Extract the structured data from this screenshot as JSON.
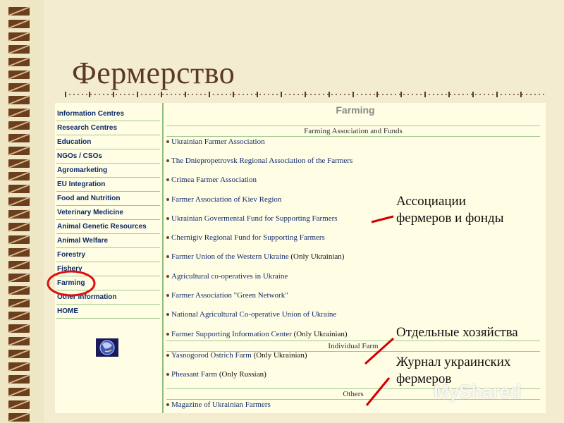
{
  "slide": {
    "title": "Фермерство"
  },
  "sidebar": {
    "items": [
      {
        "label": "Information Centres"
      },
      {
        "label": "Research Centres"
      },
      {
        "label": "Education"
      },
      {
        "label": "NGOs / CSOs"
      },
      {
        "label": "Agromarketing"
      },
      {
        "label": "EU Integration"
      },
      {
        "label": "Food and Nutrition"
      },
      {
        "label": "Veterinary Medicine"
      },
      {
        "label": "Animal Genetic Resources"
      },
      {
        "label": "Animal Welfare"
      },
      {
        "label": "Forestry"
      },
      {
        "label": "Fishery"
      },
      {
        "label": "Farming"
      },
      {
        "label": "Other information"
      },
      {
        "label": "HOME"
      }
    ],
    "highlighted_item": "Farming"
  },
  "content": {
    "heading": "Farming",
    "sections": [
      {
        "title": "Farming Association and Funds",
        "links": [
          {
            "label": "Ukrainian Farmer Association",
            "note": ""
          },
          {
            "label": "The Dniepropetrovsk Regional Association of the Farmers",
            "note": ""
          },
          {
            "label": "Crimea Farmer Association",
            "note": ""
          },
          {
            "label": "Farmer Association of Kiev Region",
            "note": ""
          },
          {
            "label": "Ukrainian Govermental Fund for Supporting Farmers",
            "note": ""
          },
          {
            "label": "Chernigiv Regional Fund for Supporting Farmers",
            "note": ""
          },
          {
            "label": "Farmer Union of the Western Ukraine",
            "note": "(Only Ukrainian)"
          },
          {
            "label": "Agricultural co-operatives in Ukraine",
            "note": ""
          },
          {
            "label": "Farmer Association \"Green Network\"",
            "note": ""
          },
          {
            "label": "National Agricultural Co-operative Union of Ukraine",
            "note": ""
          },
          {
            "label": "Farmer Supporting Information Center",
            "note": "(Only Ukrainian)"
          }
        ]
      },
      {
        "title": "Individual Farm",
        "links": [
          {
            "label": "Yasnogorod Ostrich Farm",
            "note": "(Only Ukrainian)"
          },
          {
            "label": "Pheasant Farm",
            "note": "(Only Russian)"
          }
        ]
      },
      {
        "title": "Others",
        "links": [
          {
            "label": "Magazine of Ukrainian Farmers",
            "note": ""
          }
        ]
      }
    ]
  },
  "annotations": {
    "associations": "Ассоциации фермеров и фонды",
    "associations_line1": "Ассоциации",
    "associations_line2": "фермеров и фонды",
    "individual": "Отдельные хозяйства",
    "journal": "Журнал украинских фермеров",
    "journal_line1": "Журнал украинских",
    "journal_line2": "фермеров",
    "line_color": "#d00000",
    "circle_color": "#e01010"
  },
  "watermark": "MyShared",
  "icons": {
    "logo": "globe-logo-icon",
    "bullet": "bullet-icon"
  }
}
